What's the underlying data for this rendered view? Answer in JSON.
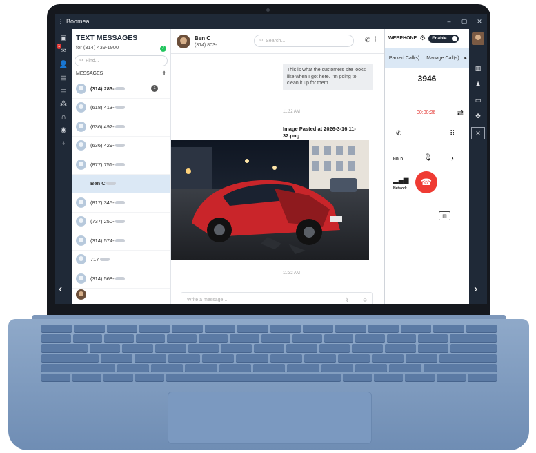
{
  "window": {
    "title": "Boomea",
    "controls": [
      "–",
      "▢",
      "✕"
    ]
  },
  "left_rail": {
    "badge_count": "1"
  },
  "messages_panel": {
    "title": "TEXT MESSAGES",
    "for_line": "for (314) 439-1900",
    "find_placeholder": "Find...",
    "section_label": "MESSAGES",
    "add_symbol": "+",
    "contacts": [
      {
        "label": "(314) 283-",
        "unread": "1",
        "bold": true,
        "photo": false,
        "selected": false
      },
      {
        "label": "(618) 413-",
        "unread": "",
        "bold": false,
        "photo": false,
        "selected": false
      },
      {
        "label": "(636) 492-",
        "unread": "",
        "bold": false,
        "photo": false,
        "selected": false
      },
      {
        "label": "(636) 429-",
        "unread": "",
        "bold": false,
        "photo": false,
        "selected": false
      },
      {
        "label": "(877) 751-",
        "unread": "",
        "bold": false,
        "photo": false,
        "selected": false
      },
      {
        "label": "Ben C",
        "unread": "",
        "bold": true,
        "photo": true,
        "selected": true
      },
      {
        "label": "(817) 345-",
        "unread": "",
        "bold": false,
        "photo": false,
        "selected": false
      },
      {
        "label": "(737) 250-",
        "unread": "",
        "bold": false,
        "photo": false,
        "selected": false
      },
      {
        "label": "(314) 574-",
        "unread": "",
        "bold": false,
        "photo": false,
        "selected": false
      },
      {
        "label": "717",
        "unread": "",
        "bold": false,
        "photo": false,
        "selected": false
      },
      {
        "label": "(314) 568-",
        "unread": "",
        "bold": false,
        "photo": false,
        "selected": false
      }
    ]
  },
  "conversation": {
    "contact_name": "Ben C",
    "contact_phone": "(314) 803-",
    "search_placeholder": "Search...",
    "messages": {
      "text_message": "This is what the customers site looks like when I got here.  I'm going to clean it up for them",
      "text_time": "11:32 AM",
      "image_caption": "Image Pasted at 2026-3-16 11-32.png",
      "image_time": "11:32 AM"
    },
    "composer_placeholder": "Write a message..."
  },
  "webphone": {
    "label": "WEBPHONE",
    "toggle_label": "Enable",
    "tabs": [
      "Parked Call(s)",
      "Manage Call(s)"
    ],
    "tab_arrow": "▸",
    "call_number": "3946",
    "call_timer": "00:00:26",
    "hold_label": "HOLD",
    "network_label": "Network"
  },
  "colors": {
    "accent_blue": "#dbe8f5",
    "hangup_red": "#ef3b33",
    "timer_red": "#e53935",
    "online_green": "#22c55e",
    "chrome_dark": "#1f2937"
  }
}
